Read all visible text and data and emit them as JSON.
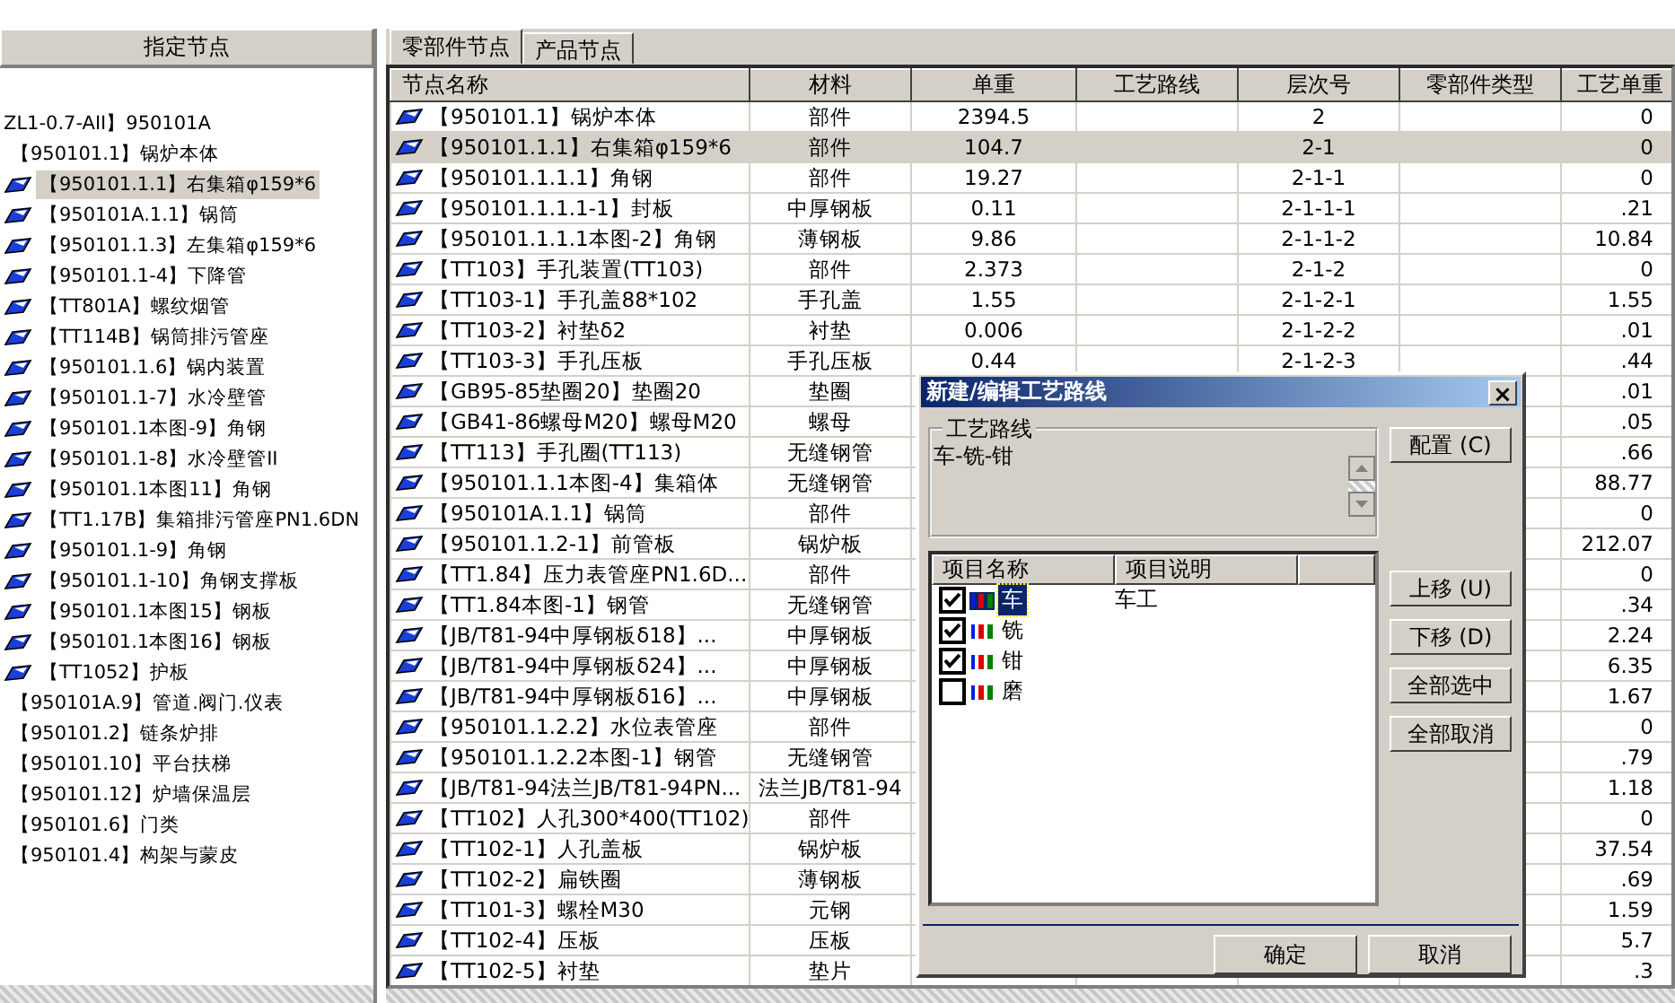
{
  "left_panel": {
    "header": "指定节点",
    "tree": [
      {
        "label": "ZL1-0.7-AII】950101A",
        "kind": "node",
        "selected": false,
        "children": [
          {
            "label": "【950101.1】锅炉本体",
            "kind": "node",
            "selected": false,
            "children": [
              {
                "label": "【950101.1.1】右集箱φ159*6",
                "kind": "part",
                "selected": true
              },
              {
                "label": "【950101A.1.1】锅筒",
                "kind": "part",
                "selected": false
              },
              {
                "label": "【950101.1.3】左集箱φ159*6",
                "kind": "part",
                "selected": false
              },
              {
                "label": "【950101.1-4】下降管",
                "kind": "part",
                "selected": false
              },
              {
                "label": "【TT801A】螺纹烟管",
                "kind": "part",
                "selected": false
              },
              {
                "label": "【TT114B】锅筒排污管座",
                "kind": "part",
                "selected": false
              },
              {
                "label": "【950101.1.6】锅内装置",
                "kind": "part",
                "selected": false
              },
              {
                "label": "【950101.1-7】水冷壁管",
                "kind": "part",
                "selected": false
              },
              {
                "label": "【950101.1本图-9】角钢",
                "kind": "part",
                "selected": false
              },
              {
                "label": "【950101.1-8】水冷壁管II",
                "kind": "part",
                "selected": false
              },
              {
                "label": "【950101.1本图11】角钢",
                "kind": "part",
                "selected": false
              },
              {
                "label": "【TT1.17B】集箱排污管座PN1.6DN",
                "kind": "part",
                "selected": false
              },
              {
                "label": "【950101.1-9】角钢",
                "kind": "part",
                "selected": false
              },
              {
                "label": "【950101.1-10】角钢支撑板",
                "kind": "part",
                "selected": false
              },
              {
                "label": "【950101.1本图15】钢板",
                "kind": "part",
                "selected": false
              },
              {
                "label": "【950101.1本图16】钢板",
                "kind": "part",
                "selected": false
              },
              {
                "label": "【TT1052】护板",
                "kind": "part",
                "selected": false
              }
            ]
          },
          {
            "label": "【950101A.9】管道.阀门.仪表",
            "kind": "node",
            "selected": false
          },
          {
            "label": "【950101.2】链条炉排",
            "kind": "node",
            "selected": false
          },
          {
            "label": "【950101.10】平台扶梯",
            "kind": "node",
            "selected": false
          },
          {
            "label": "【950101.12】炉墙保温层",
            "kind": "node",
            "selected": false
          },
          {
            "label": "【950101.6】门类",
            "kind": "node",
            "selected": false
          },
          {
            "label": "【950101.4】构架与蒙皮",
            "kind": "node",
            "selected": false
          }
        ]
      }
    ]
  },
  "tabs": [
    {
      "label": "零部件节点",
      "selected": true
    },
    {
      "label": "产品节点",
      "selected": false
    }
  ],
  "table": {
    "columns": [
      "节点名称",
      "材料",
      "单重",
      "工艺路线",
      "层次号",
      "零部件类型",
      "工艺单重"
    ],
    "rows": [
      {
        "name": "【950101.1】锅炉本体",
        "material": "部件",
        "unit_weight": "2394.5",
        "level_no": "2",
        "process_weight": "0",
        "selected": false
      },
      {
        "name": "【950101.1.1】右集箱φ159*6",
        "material": "部件",
        "unit_weight": "104.7",
        "level_no": "2-1",
        "process_weight": "0",
        "selected": true
      },
      {
        "name": "【950101.1.1.1】角钢",
        "material": "部件",
        "unit_weight": "19.27",
        "level_no": "2-1-1",
        "process_weight": "0",
        "selected": false
      },
      {
        "name": "【950101.1.1.1-1】封板",
        "material": "中厚钢板",
        "unit_weight": "0.11",
        "level_no": "2-1-1-1",
        "process_weight": ".21",
        "selected": false
      },
      {
        "name": "【950101.1.1.1本图-2】角钢",
        "material": "薄钢板",
        "unit_weight": "9.86",
        "level_no": "2-1-1-2",
        "process_weight": "10.84",
        "selected": false
      },
      {
        "name": "【TT103】手孔装置(TT103)",
        "material": "部件",
        "unit_weight": "2.373",
        "level_no": "2-1-2",
        "process_weight": "0",
        "selected": false
      },
      {
        "name": "【TT103-1】手孔盖88*102",
        "material": "手孔盖",
        "unit_weight": "1.55",
        "level_no": "2-1-2-1",
        "process_weight": "1.55",
        "selected": false
      },
      {
        "name": "【TT103-2】衬垫δ2",
        "material": "衬垫",
        "unit_weight": "0.006",
        "level_no": "2-1-2-2",
        "process_weight": ".01",
        "selected": false
      },
      {
        "name": "【TT103-3】手孔压板",
        "material": "手孔压板",
        "unit_weight": "0.44",
        "level_no": "2-1-2-3",
        "process_weight": ".44",
        "selected": false
      },
      {
        "name": "【GB95-85垫圈20】垫圈20",
        "material": "垫圈",
        "process_weight": ".01",
        "selected": false
      },
      {
        "name": "【GB41-86螺母M20】螺母M20",
        "material": "螺母",
        "process_weight": ".05",
        "selected": false
      },
      {
        "name": "【TT113】手孔圈(TT113)",
        "material": "无缝钢管",
        "process_weight": ".66",
        "selected": false
      },
      {
        "name": "【950101.1.1本图-4】集箱体",
        "material": "无缝钢管",
        "process_weight": "88.77",
        "selected": false
      },
      {
        "name": "【950101A.1.1】锅筒",
        "material": "部件",
        "process_weight": "0",
        "selected": false
      },
      {
        "name": "【950101.1.2-1】前管板",
        "material": "锅炉板",
        "process_weight": "212.07",
        "selected": false
      },
      {
        "name": "【TT1.84】压力表管座PN1.6D...",
        "material": "部件",
        "process_weight": "0",
        "selected": false
      },
      {
        "name": "【TT1.84本图-1】钢管",
        "material": "无缝钢管",
        "process_weight": ".34",
        "selected": false
      },
      {
        "name": "【JB/T81-94中厚钢板δ18】...",
        "material": "中厚钢板",
        "process_weight": "2.24",
        "selected": false
      },
      {
        "name": "【JB/T81-94中厚钢板δ24】...",
        "material": "中厚钢板",
        "process_weight": "6.35",
        "selected": false
      },
      {
        "name": "【JB/T81-94中厚钢板δ16】...",
        "material": "中厚钢板",
        "process_weight": "1.67",
        "selected": false
      },
      {
        "name": "【950101.1.2.2】水位表管座",
        "material": "部件",
        "process_weight": "0",
        "selected": false
      },
      {
        "name": "【950101.1.2.2本图-1】钢管",
        "material": "无缝钢管",
        "process_weight": ".79",
        "selected": false
      },
      {
        "name": "【JB/T81-94法兰JB/T81-94PN...",
        "material": "法兰JB/T81-94",
        "process_weight": "1.18",
        "selected": false
      },
      {
        "name": "【TT102】人孔300*400(TT102)",
        "material": "部件",
        "process_weight": "0",
        "selected": false
      },
      {
        "name": "【TT102-1】人孔盖板",
        "material": "锅炉板",
        "process_weight": "37.54",
        "selected": false
      },
      {
        "name": "【TT102-2】扁铁圈",
        "material": "薄钢板",
        "process_weight": ".69",
        "selected": false
      },
      {
        "name": "【TT101-3】螺栓M30",
        "material": "元钢",
        "process_weight": "1.59",
        "selected": false
      },
      {
        "name": "【TT102-4】压板",
        "material": "压板",
        "process_weight": "5.7",
        "selected": false
      },
      {
        "name": "【TT102-5】衬垫",
        "material": "垫片",
        "process_weight": ".3",
        "selected": false
      }
    ]
  },
  "dialog": {
    "title": "新建/编辑工艺路线",
    "close": "×",
    "route_group": {
      "label": "工艺路线",
      "value": "车-铣-钳"
    },
    "side_buttons": [
      "配置 (C)",
      "上移 (U)",
      "下移 (D)",
      "全部选中",
      "全部取消"
    ],
    "list": {
      "columns": [
        "项目名称",
        "项目说明"
      ],
      "items": [
        {
          "name": "车",
          "description": "车工",
          "checked": true,
          "selected": true
        },
        {
          "name": "铣",
          "checked": true,
          "selected": false
        },
        {
          "name": "钳",
          "checked": true,
          "selected": false
        },
        {
          "name": "磨",
          "checked": false,
          "selected": false
        }
      ]
    },
    "buttons": [
      "确定",
      "取消"
    ]
  }
}
